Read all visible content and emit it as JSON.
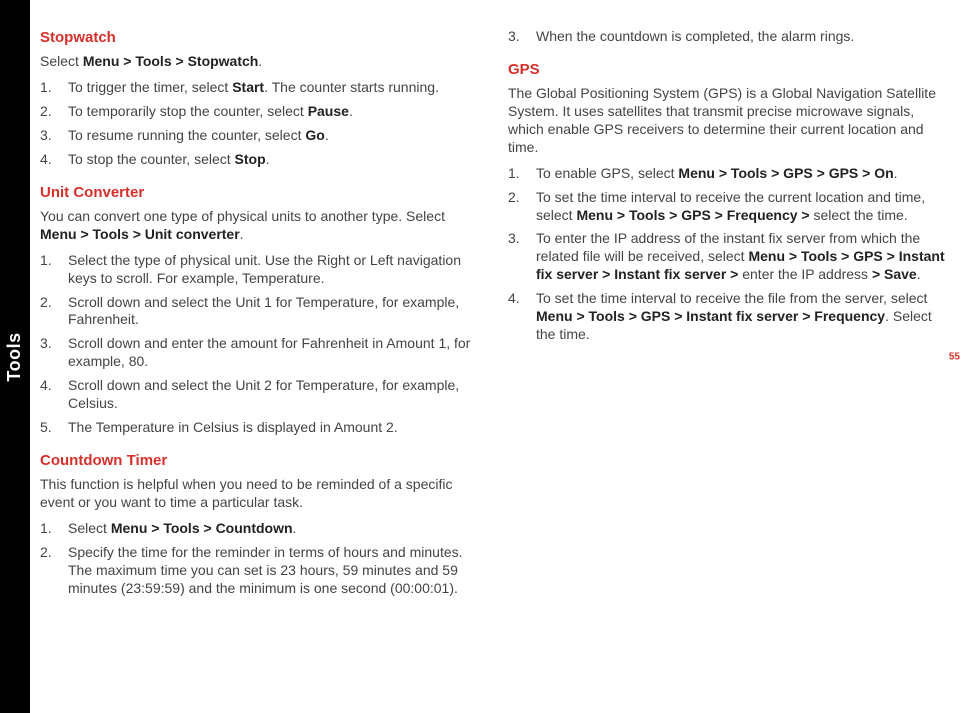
{
  "tab_label": "Tools",
  "page_number": "55",
  "left": {
    "stopwatch": {
      "title": "Stopwatch",
      "intro_pre": "Select ",
      "intro_b": "Menu > Tools > Stopwatch",
      "intro_post": ".",
      "steps": [
        {
          "n": "1.",
          "pre": "To trigger the timer, select ",
          "b": "Start",
          "post": ". The counter starts running."
        },
        {
          "n": "2.",
          "pre": "To temporarily stop the counter, select ",
          "b": "Pause",
          "post": "."
        },
        {
          "n": "3.",
          "pre": "To resume running the counter, select ",
          "b": "Go",
          "post": "."
        },
        {
          "n": "4.",
          "pre": "To stop the counter, select ",
          "b": "Stop",
          "post": "."
        }
      ]
    },
    "unit": {
      "title": "Unit Converter",
      "intro_pre": "You can convert one type of physical units to another type. Select ",
      "intro_b": "Menu > Tools > Unit converter",
      "intro_post": ".",
      "steps": [
        {
          "n": "1.",
          "pre": "Select the type of physical unit. Use the Right or Left navigation keys to scroll. For example, Temperature.",
          "b": "",
          "post": ""
        },
        {
          "n": "2.",
          "pre": "Scroll down and select the Unit 1 for Temperature, for example, Fahrenheit.",
          "b": "",
          "post": ""
        },
        {
          "n": "3.",
          "pre": "Scroll down and enter the amount for Fahrenheit in Amount 1, for example, 80.",
          "b": "",
          "post": ""
        },
        {
          "n": "4.",
          "pre": "Scroll down and select the Unit 2 for Temperature, for example, Celsius.",
          "b": "",
          "post": ""
        },
        {
          "n": "5.",
          "pre": "The Temperature in Celsius is displayed in Amount 2.",
          "b": "",
          "post": ""
        }
      ]
    },
    "countdown": {
      "title": "Countdown Timer",
      "intro": "This function is helpful when you need to be reminded of a specific event or you want to time a particular task.",
      "steps": [
        {
          "n": "1.",
          "pre": "Select ",
          "b": "Menu > Tools > Countdown",
          "post": "."
        },
        {
          "n": "2.",
          "pre": "Specify the time for the reminder in terms of hours and minutes. The maximum time you can set is 23 hours, 59 minutes and 59 minutes (23:59:59) and the minimum is one second (00:00:01).",
          "b": "",
          "post": ""
        }
      ]
    }
  },
  "right": {
    "countdown_cont": [
      {
        "n": "3.",
        "pre": "When the countdown is completed, the alarm rings.",
        "b": "",
        "post": ""
      }
    ],
    "gps": {
      "title": "GPS",
      "intro": "The Global Positioning System (GPS) is a Global Navigation Satellite System. It uses satellites that transmit precise microwave signals, which enable GPS receivers to determine their current location and time.",
      "steps": [
        {
          "n": "1.",
          "pre": "To enable GPS, select ",
          "b": "Menu > Tools > GPS > GPS > On",
          "post": "."
        },
        {
          "n": "2.",
          "pre": "To set the time interval to receive the current location and time, select ",
          "b": "Menu > Tools > GPS > Frequency >",
          "post": " select the time."
        },
        {
          "n": "3.",
          "pre": "To enter the IP address of the instant fix server from which the related file will be received, select ",
          "b": "Menu > Tools > GPS > Instant fix server > Instant fix server >",
          "post": " enter the IP address ",
          "b2": "> Save",
          "post2": "."
        },
        {
          "n": "4.",
          "pre": "To set the time interval to receive the file from the server, select ",
          "b": "Menu > Tools > GPS > Instant fix server > Frequency",
          "post": ". Select the time."
        }
      ]
    }
  }
}
